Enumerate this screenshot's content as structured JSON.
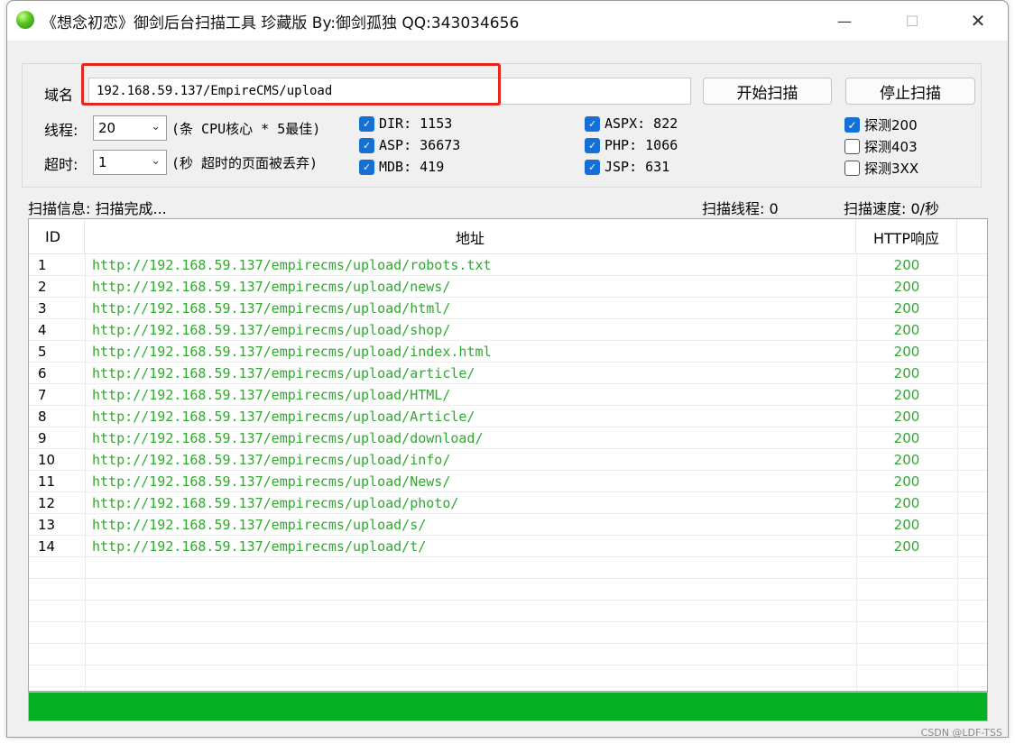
{
  "window": {
    "title": "《想念初恋》御剑后台扫描工具 珍藏版 By:御剑孤独 QQ:343034656",
    "minimize_icon": "—",
    "maximize_icon": "☐",
    "close_icon": "✕"
  },
  "form": {
    "domain_label": "域名",
    "domain_value": "192.168.59.137/EmpireCMS/upload",
    "start_button": "开始扫描",
    "stop_button": "停止扫描",
    "threads_label": "线程:",
    "threads_value": "20",
    "threads_hint": "(条 CPU核心 * 5最佳)",
    "timeout_label": "超时:",
    "timeout_value": "1",
    "timeout_hint": "(秒 超时的页面被丢弃)"
  },
  "dictionaries": [
    {
      "label": "DIR: 1153",
      "checked": true
    },
    {
      "label": "ASP: 36673",
      "checked": true
    },
    {
      "label": "MDB: 419",
      "checked": true
    },
    {
      "label": "ASPX: 822",
      "checked": true
    },
    {
      "label": "PHP: 1066",
      "checked": true
    },
    {
      "label": "JSP: 631",
      "checked": true
    }
  ],
  "probes": [
    {
      "label": "探测200",
      "checked": true
    },
    {
      "label": "探测403",
      "checked": false
    },
    {
      "label": "探测3XX",
      "checked": false
    }
  ],
  "status": {
    "info": "扫描信息: 扫描完成...",
    "threads": "扫描线程: 0",
    "speed": "扫描速度: 0/秒"
  },
  "table": {
    "headers": [
      "ID",
      "地址",
      "HTTP响应"
    ],
    "rows": [
      {
        "id": "1",
        "url": "http://192.168.59.137/empirecms/upload/robots.txt",
        "code": "200"
      },
      {
        "id": "2",
        "url": "http://192.168.59.137/empirecms/upload/news/",
        "code": "200"
      },
      {
        "id": "3",
        "url": "http://192.168.59.137/empirecms/upload/html/",
        "code": "200"
      },
      {
        "id": "4",
        "url": "http://192.168.59.137/empirecms/upload/shop/",
        "code": "200"
      },
      {
        "id": "5",
        "url": "http://192.168.59.137/empirecms/upload/index.html",
        "code": "200"
      },
      {
        "id": "6",
        "url": "http://192.168.59.137/empirecms/upload/article/",
        "code": "200"
      },
      {
        "id": "7",
        "url": "http://192.168.59.137/empirecms/upload/HTML/",
        "code": "200"
      },
      {
        "id": "8",
        "url": "http://192.168.59.137/empirecms/upload/Article/",
        "code": "200"
      },
      {
        "id": "9",
        "url": "http://192.168.59.137/empirecms/upload/download/",
        "code": "200"
      },
      {
        "id": "10",
        "url": "http://192.168.59.137/empirecms/upload/info/",
        "code": "200"
      },
      {
        "id": "11",
        "url": "http://192.168.59.137/empirecms/upload/News/",
        "code": "200"
      },
      {
        "id": "12",
        "url": "http://192.168.59.137/empirecms/upload/photo/",
        "code": "200"
      },
      {
        "id": "13",
        "url": "http://192.168.59.137/empirecms/upload/s/",
        "code": "200"
      },
      {
        "id": "14",
        "url": "http://192.168.59.137/empirecms/upload/t/",
        "code": "200"
      }
    ],
    "empty_rows": 6
  },
  "progress": {
    "fraction": 1.0,
    "color": "#06b025"
  },
  "colors": {
    "url_text": "#2eaa2e",
    "highlight_box": "#e8271c",
    "checkbox_on": "#1570d6"
  },
  "watermark": "CSDN @LDF-TSS"
}
